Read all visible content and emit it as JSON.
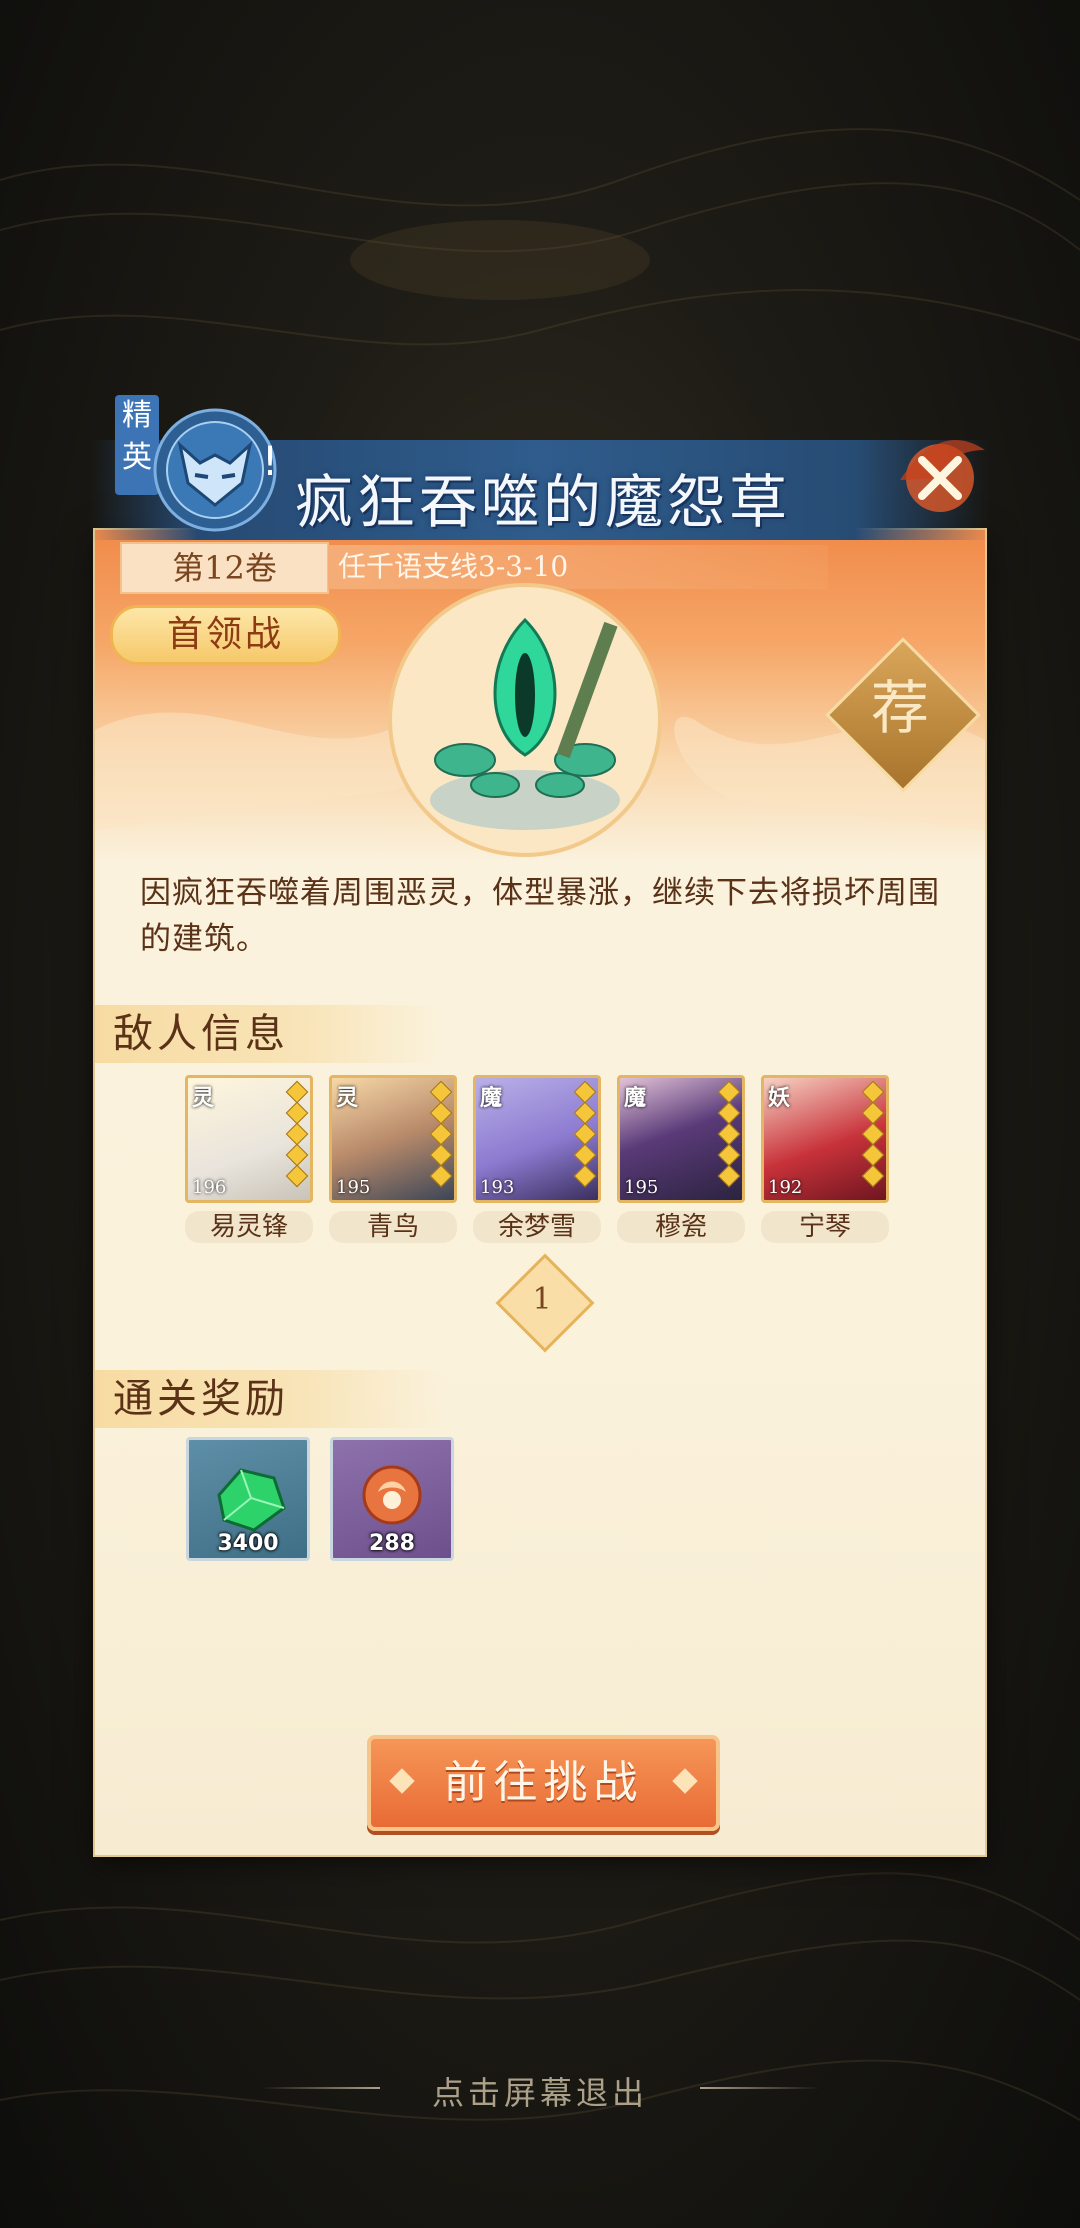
{
  "stage": {
    "elite_tag": "精英",
    "title": "疯狂吞噬的魔怨草",
    "chapter": "第12卷",
    "branch": "任千语支线3-3-10",
    "boss_badge": "首领战",
    "recommend": "荐",
    "description": "因疯狂吞噬着周围恶灵，体型暴涨，继续下去将损坏周围的建筑。"
  },
  "enemy_section": {
    "title": "敌人信息",
    "enemies": [
      {
        "faction": "灵",
        "level": "196",
        "name": "易灵锋",
        "color": "#e9e4dc"
      },
      {
        "faction": "灵",
        "level": "195",
        "name": "青鸟",
        "color": "#3c4657"
      },
      {
        "faction": "魔",
        "level": "193",
        "name": "余梦雪",
        "color": "#8c7ad0"
      },
      {
        "faction": "魔",
        "level": "195",
        "name": "穆瓷",
        "color": "#2b2340"
      },
      {
        "faction": "妖",
        "level": "192",
        "name": "宁琴",
        "color": "#c8323a"
      }
    ],
    "page": "1"
  },
  "reward_section": {
    "title": "通关奖励",
    "rewards": [
      {
        "icon": "green-gem-icon",
        "count": "3400",
        "bg": "#3f6f86"
      },
      {
        "icon": "flame-orb-icon",
        "count": "288",
        "bg": "#6d4f8c"
      }
    ]
  },
  "challenge_button": "前往挑战",
  "exit_hint": "点击屏幕退出"
}
